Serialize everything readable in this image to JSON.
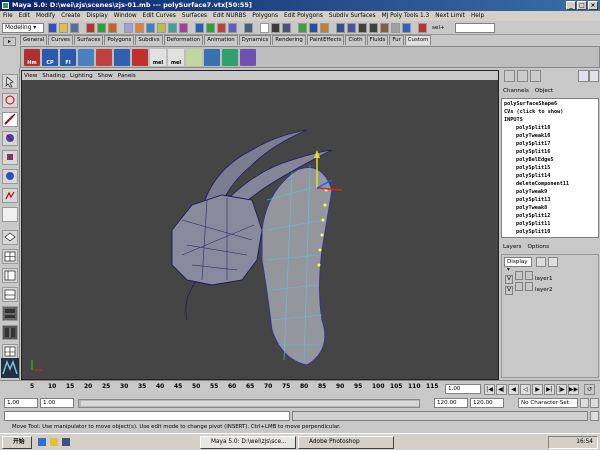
{
  "title": "Maya 5.0: D:\\wei\\zjs\\scenes\\zjs-01.mb  ---  polySurface7.vtx[50:55]",
  "menubar": [
    "File",
    "Edit",
    "Modify",
    "Create",
    "Display",
    "Window",
    "Edit Curves",
    "Surfaces",
    "Edit NURBS",
    "Polygons",
    "Edit Polygons",
    "Subdiv Surfaces",
    "MJ Poly Tools 1.3",
    "Next Limit",
    "Help"
  ],
  "status": {
    "mode": "Modeling",
    "sel_label": "sel+"
  },
  "shelf_tabs": [
    "General",
    "Curves",
    "Surfaces",
    "Polygons",
    "Subdivs",
    "Deformation",
    "Animation",
    "Dynamics",
    "Rendering",
    "PaintEffects",
    "Cloth",
    "Fluids",
    "Fur",
    "Custom"
  ],
  "shelf_active": "Custom",
  "shelf_icons": [
    {
      "name": "hm-shelf-icon",
      "label": "Hm",
      "color": "#b03030"
    },
    {
      "name": "cp-shelf-icon",
      "label": "CP",
      "color": "#2a5ab0"
    },
    {
      "name": "fi-shelf-icon",
      "label": "FI",
      "color": "#2a5ab0"
    },
    {
      "name": "tool-shelf-icon-1",
      "label": "",
      "color": "#4a7fc0"
    },
    {
      "name": "tool-shelf-icon-2",
      "label": "",
      "color": "#c04040"
    },
    {
      "name": "tool-shelf-icon-3",
      "label": "",
      "color": "#3060b0"
    },
    {
      "name": "tool-shelf-icon-4",
      "label": "",
      "color": "#c03030"
    },
    {
      "name": "mel-shelf-icon-1",
      "label": "mel",
      "color": "#e0e0e0"
    },
    {
      "name": "mel-shelf-icon-2",
      "label": "mel",
      "color": "#e0e0e0"
    },
    {
      "name": "tool-shelf-icon-5",
      "label": "",
      "color": "#c0d8a0"
    },
    {
      "name": "tool-shelf-icon-6",
      "label": "",
      "color": "#3a70b0"
    },
    {
      "name": "tool-shelf-icon-7",
      "label": "",
      "color": "#30a070"
    },
    {
      "name": "tool-shelf-icon-8",
      "label": "",
      "color": "#7050b0"
    }
  ],
  "viewport_menu": [
    "View",
    "Shading",
    "Lighting",
    "Show",
    "Panels"
  ],
  "channels": {
    "menu": [
      "Channels",
      "Object"
    ],
    "object": "polySurfaceShape6",
    "cvs": "CVs (click to show)",
    "inputs_label": "INPUTS",
    "inputs": [
      "polySplit18",
      "polyTweak10",
      "polySplit17",
      "polySplit16",
      "polyBelEdge5",
      "polySplit15",
      "polySplit14",
      "deleteComponent11",
      "polyTweak9",
      "polySplit13",
      "polyTweak8",
      "polySplit12",
      "polySplit11",
      "polySplit10",
      "polySplit9"
    ]
  },
  "layers": {
    "menu": [
      "Layers",
      "Options"
    ],
    "display": "Display",
    "items": [
      {
        "v": "V",
        "name": "layer1"
      },
      {
        "v": "V",
        "name": "layer2"
      }
    ]
  },
  "timeline": {
    "ticks": [
      "5",
      "10",
      "15",
      "20",
      "25",
      "30",
      "35",
      "40",
      "45",
      "50",
      "55",
      "60",
      "65",
      "70",
      "75",
      "80",
      "85",
      "90",
      "95",
      "100",
      "105",
      "110",
      "115"
    ],
    "current": "1.00"
  },
  "range": {
    "start": "1.00",
    "start2": "1.00",
    "end": "120.00",
    "end2": "120.00",
    "char_set": "No Character Set"
  },
  "help": "Move Tool: Use manipulator to move object(s). Use edit mode to change pivot (INSERT). Ctrl+LMB to move perpendicular.",
  "taskbar": {
    "start": "开始",
    "items": [
      "Maya 5.0: D:\\wei\\zjs\\sce...",
      "Adobe Photoshop"
    ],
    "clock": "16:54"
  }
}
